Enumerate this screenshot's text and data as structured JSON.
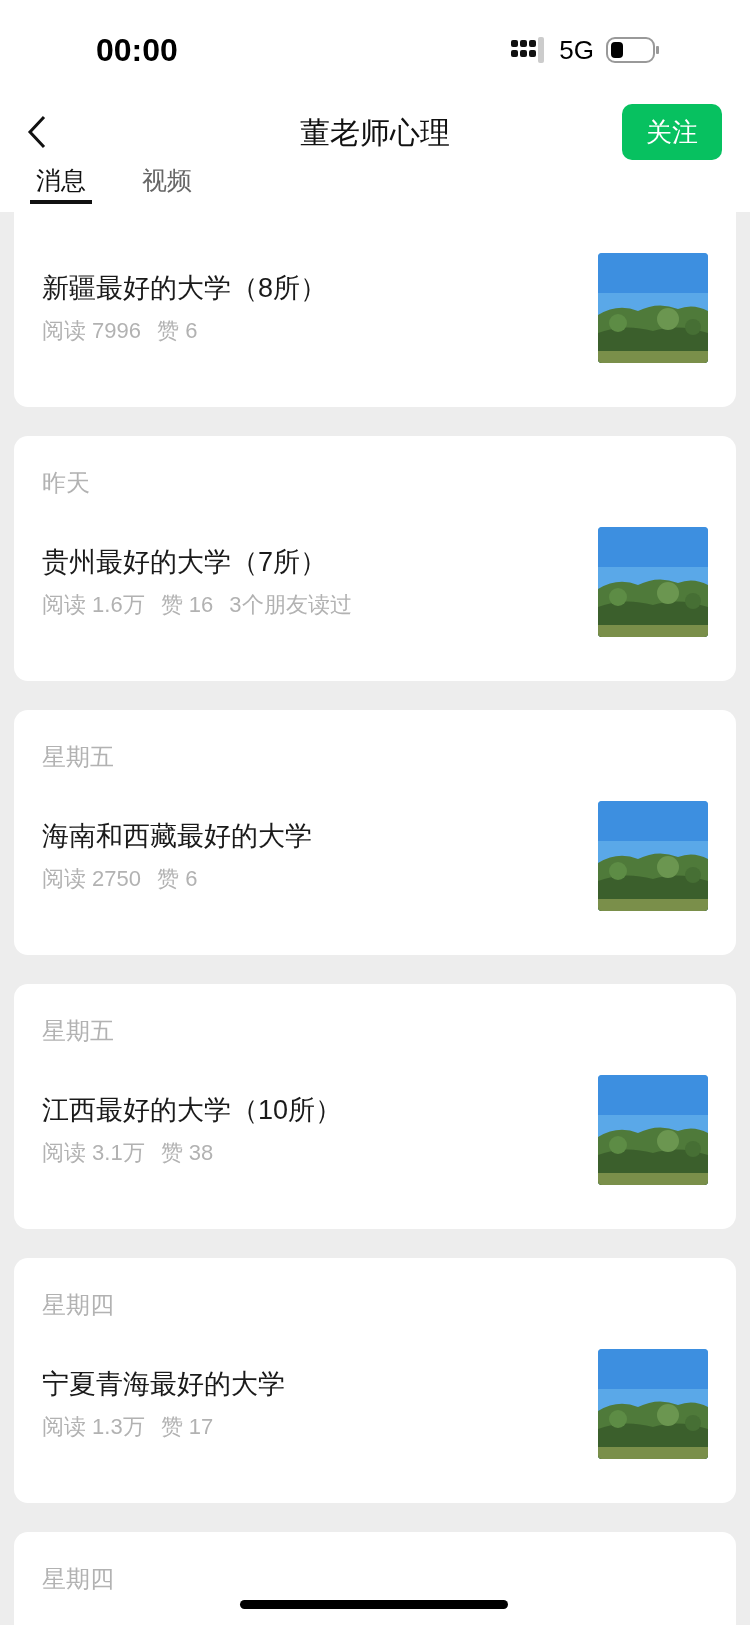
{
  "status_bar": {
    "time": "00:00",
    "network": "5G"
  },
  "header": {
    "title": "董老师心理",
    "follow_button": "关注"
  },
  "tabs": [
    {
      "label": "消息",
      "selected": true
    },
    {
      "label": "视频",
      "selected": false
    }
  ],
  "messages": [
    {
      "title": "新疆最好的大学（8所）",
      "stats": [
        "阅读 7996",
        "赞 6"
      ],
      "thumbnail": {
        "kind": "picture"
      }
    },
    {
      "date": "昨天",
      "title": "贵州最好的大学（7所）",
      "stats": [
        "阅读 1.6万",
        "赞 16",
        "3个朋友读过"
      ],
      "thumbnail": {
        "kind": "picture"
      }
    },
    {
      "date": "星期五",
      "title": "海南和西藏最好的大学",
      "stats": [
        "阅读 2750",
        "赞 6"
      ],
      "thumbnail": {
        "kind": "picture"
      }
    },
    {
      "date": "星期五",
      "title": "江西最好的大学（10所）",
      "stats": [
        "阅读 3.1万",
        "赞 38"
      ],
      "thumbnail": {
        "kind": "picture"
      }
    },
    {
      "date": "星期四",
      "title": "宁夏青海最好的大学",
      "stats": [
        "阅读 1.3万",
        "赞 17"
      ],
      "thumbnail": {
        "kind": "picture"
      }
    },
    {
      "date": "星期四"
    }
  ]
}
